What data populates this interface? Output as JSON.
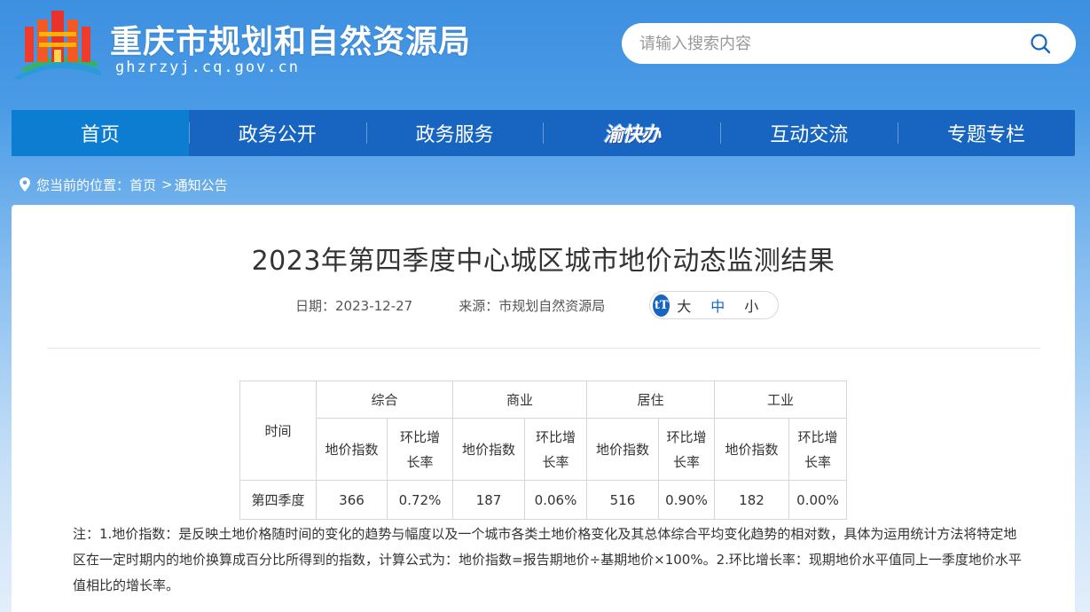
{
  "site": {
    "title": "重庆市规划和自然资源局",
    "domain": "ghzrzyj.cq.gov.cn"
  },
  "search": {
    "placeholder": "请输入搜索内容",
    "value": ""
  },
  "nav": {
    "items": [
      {
        "label": "首页",
        "active": true
      },
      {
        "label": "政务公开"
      },
      {
        "label": "政务服务"
      },
      {
        "label": "渝快办"
      },
      {
        "label": "互动交流"
      },
      {
        "label": "专题专栏"
      }
    ]
  },
  "breadcrumb": {
    "prefix": "您当前的位置：",
    "home": "首页",
    "separator": ">",
    "current": "通知公告"
  },
  "article": {
    "title": "2023年第四季度中心城区城市地价动态监测结果",
    "date_label": "日期：",
    "date": "2023-12-27",
    "source_label": "来源：",
    "source": "市规划自然资源局",
    "font_sizes": [
      "大",
      "中",
      "小"
    ],
    "font_size_selected": "中"
  },
  "table": {
    "time_header": "时间",
    "groups": [
      "综合",
      "商业",
      "居住",
      "工业"
    ],
    "sub_headers": [
      "地价指数",
      "环比增长率"
    ],
    "rows": [
      {
        "time": "第四季度",
        "values": [
          "366",
          "0.72%",
          "187",
          "0.06%",
          "516",
          "0.90%",
          "182",
          "0.00%"
        ]
      }
    ]
  },
  "note": "注：1.地价指数：是反映土地价格随时间的变化的趋势与幅度以及一个城市各类土地价格变化及其总体综合平均变化趋势的相对数，具体为运用统计方法将特定地区在一定时期内的地价换算成百分比所得到的指数，计算公式为：地价指数=报告期地价÷基期地价×100%。2.环比增长率：现期地价水平值同上一季度地价水平值相比的增长率。",
  "colors": {
    "brand_blue": "#1765c0",
    "nav_active": "#0c7dd0"
  }
}
